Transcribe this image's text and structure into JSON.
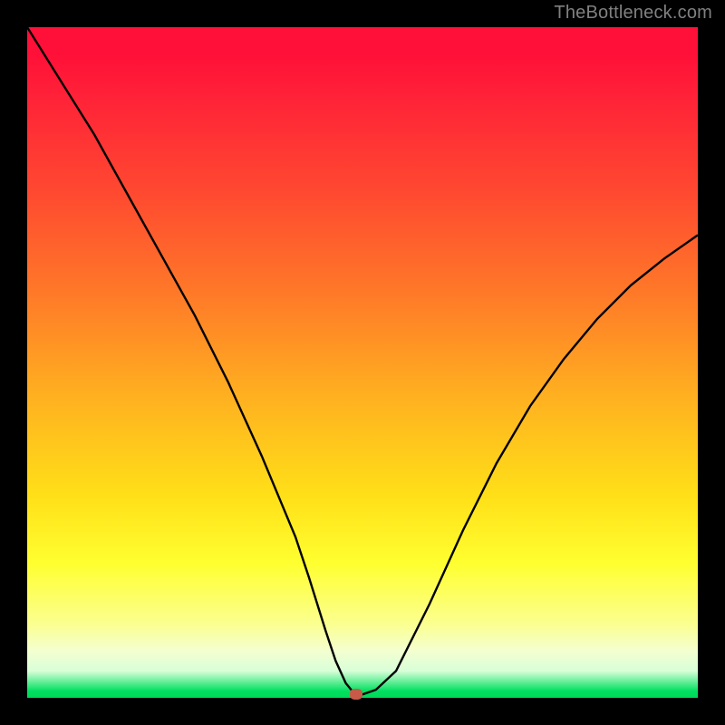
{
  "watermark": "TheBottleneck.com",
  "chart_data": {
    "type": "line",
    "title": "",
    "xlabel": "",
    "ylabel": "",
    "xlim": [
      0,
      100
    ],
    "ylim": [
      0,
      100
    ],
    "grid": false,
    "series": [
      {
        "name": "bottleneck-curve",
        "x": [
          0,
          5,
          10,
          15,
          20,
          25,
          30,
          35,
          40,
          42,
          44.5,
          46,
          47.5,
          48.8,
          50,
          52,
          55,
          60,
          65,
          70,
          75,
          80,
          85,
          90,
          95,
          100
        ],
        "values": [
          100,
          92,
          84,
          75,
          66,
          57,
          47,
          36,
          24,
          18,
          10,
          5.5,
          2.2,
          0.6,
          0.5,
          1.2,
          4,
          14,
          25,
          35,
          43.5,
          50.5,
          56.5,
          61.5,
          65.5,
          69
        ]
      }
    ],
    "marker": {
      "x": 49.0,
      "y": 0.6
    },
    "colors": {
      "curve": "#000000",
      "marker": "#c85a4a"
    }
  }
}
